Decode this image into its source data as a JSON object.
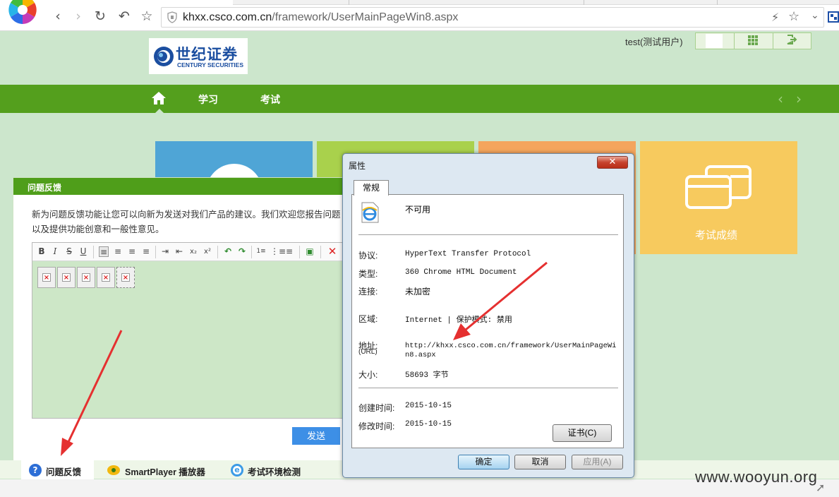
{
  "browser": {
    "url_host": "khxx.csco.com.cn",
    "url_path": "/framework/UserMainPageWin8.aspx",
    "icons": [
      "back-icon",
      "forward-icon",
      "refresh-icon",
      "undo-icon",
      "star-icon",
      "shield-icon",
      "lightning-icon",
      "bookmark-star-icon",
      "chevron-down-icon",
      "qrcode-icon"
    ]
  },
  "header": {
    "logo_cn": "世纪证券",
    "logo_en": "CENTURY SECURITIES",
    "user": "test(测试用户)",
    "nav": [
      "学习",
      "考试"
    ]
  },
  "tiles": {
    "score_label": "考试成绩",
    "colors": [
      "#4fa5d6",
      "#a9d14c",
      "#f4a55d",
      "#f7ca5e"
    ]
  },
  "feedback": {
    "title": "问题反馈",
    "description": "新为问题反馈功能让您可以向新为发送对我们产品的建议。我们欢迎您报告问题以及提供功能创意和一般性意见。",
    "send": "发送",
    "toolbar": [
      "B",
      "I",
      "S",
      "U"
    ]
  },
  "bottom": {
    "items": [
      "问题反馈",
      "SmartPlayer 播放器",
      "考试环境检测"
    ]
  },
  "dialog": {
    "title": "属性",
    "tab": "常规",
    "header_value": "不可用",
    "rows": {
      "protocol_label": "协议:",
      "protocol": "HyperText Transfer Protocol",
      "type_label": "类型:",
      "type": "360 Chrome HTML Document",
      "connection_label": "连接:",
      "connection": "未加密",
      "zone_label": "区域:",
      "zone": "Internet | 保护模式: 禁用",
      "address_label": "地址:",
      "address_label2": "(URL)",
      "address_line1": "http://khxx.csco.com.cn/framework/UserMainPageWi",
      "address_line2": "n8.aspx",
      "size_label": "大小:",
      "size": "58693 字节",
      "created_label": "创建时间:",
      "created": "2015-10-15",
      "modified_label": "修改时间:",
      "modified": "2015-10-15"
    },
    "cert_button": "证书(C)",
    "ok": "确定",
    "cancel": "取消",
    "apply": "应用(A)"
  },
  "watermark": "www.wooyun.org"
}
